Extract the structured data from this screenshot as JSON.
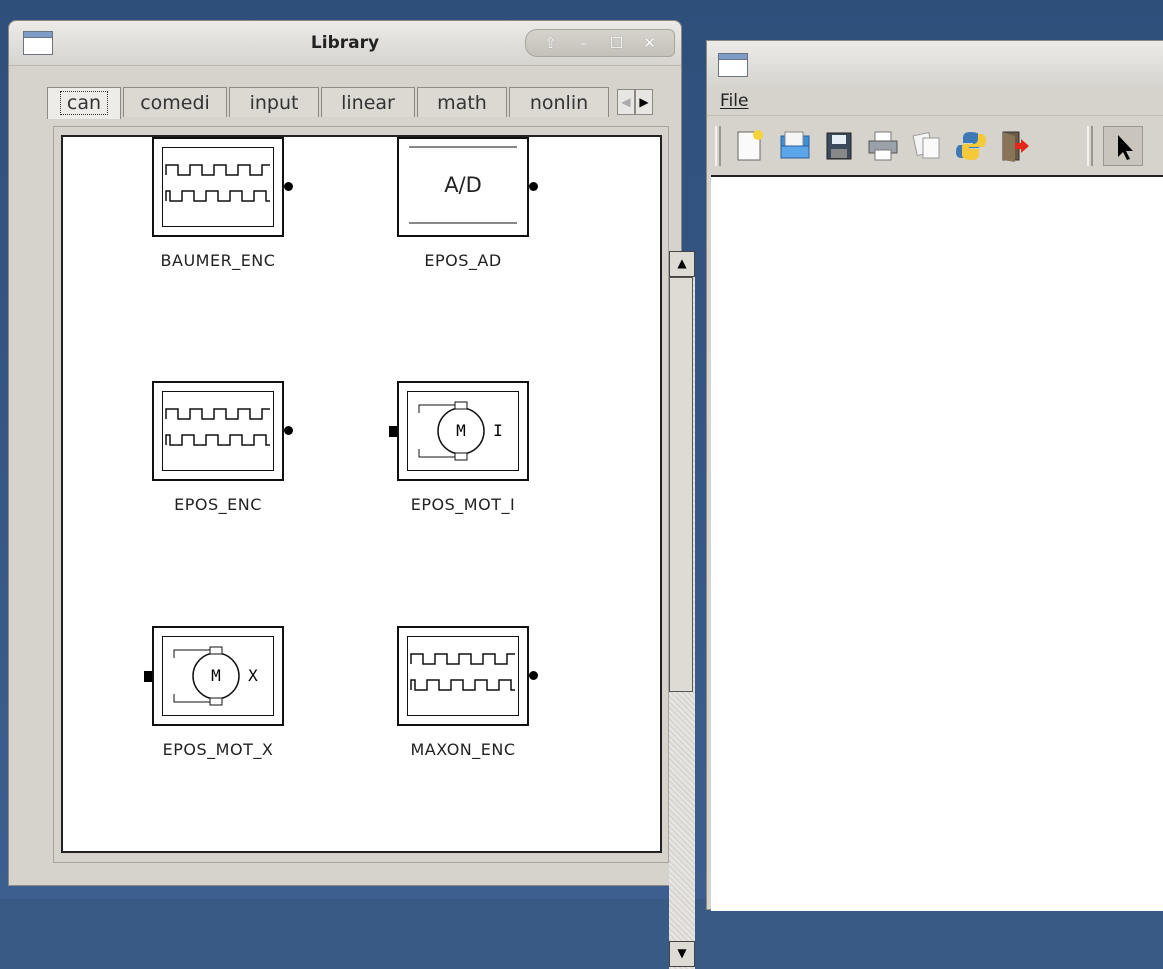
{
  "library_window": {
    "title": "Library",
    "wm_buttons": [
      "⇧",
      "–",
      "☐",
      "✕"
    ],
    "tabs": [
      {
        "label": "can",
        "active": true
      },
      {
        "label": "comedi"
      },
      {
        "label": "input"
      },
      {
        "label": "linear"
      },
      {
        "label": "math"
      },
      {
        "label": "nonlin"
      }
    ],
    "tab_scroll": {
      "left": "◀",
      "right": "▶"
    },
    "scrollbar": {
      "up": "▲",
      "down": "▼"
    },
    "blocks": [
      {
        "name": "BAUMER_ENC",
        "icon": "encoder-icon"
      },
      {
        "name": "EPOS_AD",
        "icon": "ad-converter-icon",
        "text": "A/D"
      },
      {
        "name": "EPOS_ENC",
        "icon": "encoder-icon"
      },
      {
        "name": "EPOS_MOT_I",
        "icon": "motor-icon",
        "motor_letter": "M",
        "mode_letter": "I"
      },
      {
        "name": "EPOS_MOT_X",
        "icon": "motor-icon",
        "motor_letter": "M",
        "mode_letter": "X"
      },
      {
        "name": "MAXON_ENC",
        "icon": "encoder-icon"
      }
    ]
  },
  "editor_window": {
    "menu": {
      "file": "File"
    },
    "toolbar_icons": [
      "new-file-icon",
      "open-file-icon",
      "save-icon",
      "print-icon",
      "copy-icon",
      "python-icon",
      "exit-icon",
      "pointer-icon"
    ]
  },
  "colors": {
    "desktop": "#3a5a86",
    "window_bg": "#d6d3cc",
    "canvas": "#ffffff"
  }
}
